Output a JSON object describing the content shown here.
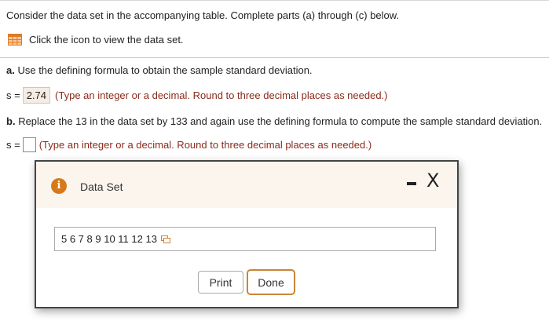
{
  "intro": "Consider the data set in the accompanying table. Complete parts (a) through (c) below.",
  "dataset_link": {
    "label": "Click the icon to view the data set.",
    "icon": "table-icon"
  },
  "part_a": {
    "letter": "a.",
    "question": "Use the defining formula to obtain the sample standard deviation.",
    "var_label": "s =",
    "answer": "2.74",
    "hint": "(Type an integer or a decimal. Round to three decimal places as needed.)"
  },
  "part_b": {
    "letter": "b.",
    "question": "Replace the 13 in the data set by 133 and again use the defining formula to compute the sample standard deviation.",
    "var_label": "s =",
    "answer": "",
    "hint": "(Type an integer or a decimal. Round to three decimal places as needed.)"
  },
  "modal": {
    "title": "Data Set",
    "info_icon": "i",
    "close_glyph": "X",
    "data": "5 6 7 8 9 10 11 12 13",
    "print_label": "Print",
    "done_label": "Done"
  },
  "colors": {
    "accent": "#c98538",
    "hint": "#8a2a1a",
    "info": "#d67a19",
    "icon_grid": "#e07b24"
  }
}
